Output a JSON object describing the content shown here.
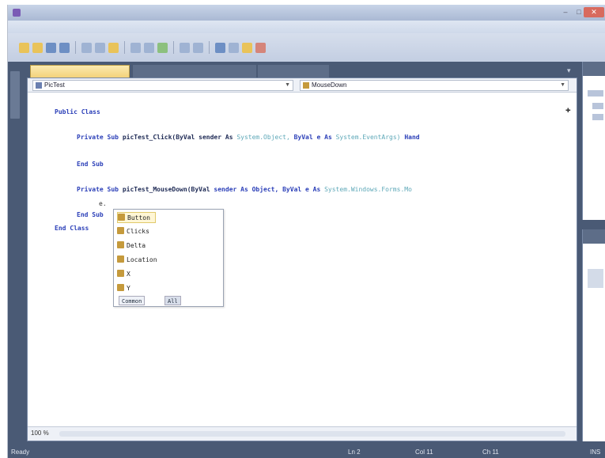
{
  "window": {
    "title": ""
  },
  "menu": [],
  "tabs": [
    {
      "label": "",
      "active": true
    },
    {
      "label": "",
      "active": false
    },
    {
      "label": "",
      "active": false
    }
  ],
  "editor": {
    "left_dropdown": "PicTest",
    "right_dropdown": "MouseDown",
    "code": {
      "line0": {
        "kw": "Public Class",
        "rest": ""
      },
      "line1": {
        "kw": "Private Sub",
        "name": "picTest_Click(ByVal",
        "rest1": "sender As",
        "type1": "System.Object,",
        "rest2": "ByVal e As",
        "type2": "System.EventArgs)",
        "tail": "Hand"
      },
      "line2": {
        "kw": "End Sub"
      },
      "line3": {
        "kw": "Private Sub",
        "name": "picTest_MouseDown(ByVal",
        "rest1": "sender As Object, ByVal e As",
        "type1": "System.Windows.Forms.Mo"
      },
      "line4": {
        "kw": "End Sub"
      },
      "line5": {
        "kw": "End Class"
      }
    },
    "intellisense": {
      "items": [
        "Button",
        "Clicks",
        "Delta",
        "Location",
        "X",
        "Y"
      ],
      "tab_common": "Common",
      "tab_all": "All"
    },
    "zoom": "100 %"
  },
  "status": {
    "text": "Ready",
    "ln": "Ln 2",
    "col": "Col 11",
    "ch": "Ch 11",
    "mode": "INS"
  }
}
